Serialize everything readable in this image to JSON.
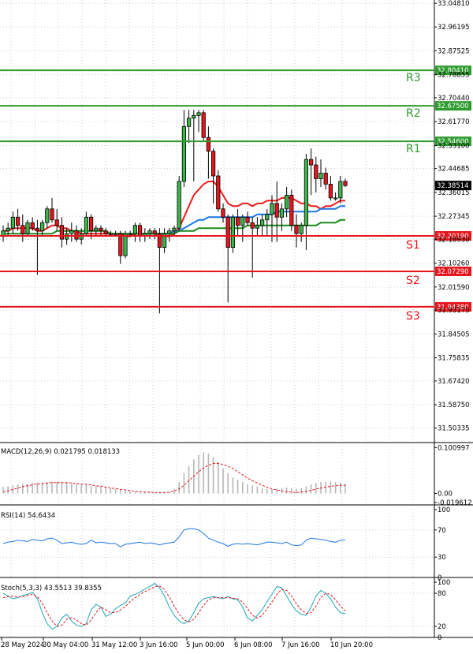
{
  "chart_data": {
    "type": "candlestick",
    "price_axis": {
      "range": [
        31.45,
        33.06
      ],
      "tick_labels": [
        "33.04810",
        "32.96195",
        "32.87525",
        "32.78855",
        "32.70440",
        "32.61770",
        "32.53100",
        "32.44685",
        "32.36015",
        "32.27345",
        "32.18930",
        "32.10260",
        "32.01590",
        "31.93175",
        "31.84505",
        "31.75835",
        "31.67420",
        "31.58750",
        "31.50335"
      ]
    },
    "levels": [
      {
        "name": "R3",
        "value": 32.8041,
        "label": "32.80410",
        "color": "#2e9b2e"
      },
      {
        "name": "R2",
        "value": 32.675,
        "label": "32.67500",
        "color": "#2e9b2e"
      },
      {
        "name": "R1",
        "value": 32.546,
        "label": "32.54600",
        "color": "#2e9b2e"
      },
      {
        "name": "S1",
        "value": 32.2019,
        "label": "32.20190",
        "color": "#e8141b"
      },
      {
        "name": "S2",
        "value": 32.0729,
        "label": "32.07290",
        "color": "#e8141b"
      },
      {
        "name": "S3",
        "value": 31.9438,
        "label": "31.94380",
        "color": "#e8141b"
      }
    ],
    "current_price": {
      "value": 32.38514,
      "label": "32.38514"
    },
    "x_tick_labels": [
      "28 May 2024",
      "30 May 04:00",
      "31 May 12:00",
      "3 Jun 16:00",
      "5 Jun 00:00",
      "6 Jun 08:00",
      "7 Jun 16:00",
      "10 Jun 20:00"
    ],
    "candles": [
      [
        32.2,
        32.24,
        32.18,
        32.22
      ],
      [
        32.22,
        32.25,
        32.2,
        32.23
      ],
      [
        32.23,
        32.29,
        32.21,
        32.27
      ],
      [
        32.27,
        32.3,
        32.22,
        32.24
      ],
      [
        32.24,
        32.28,
        32.18,
        32.21
      ],
      [
        32.21,
        32.26,
        32.2,
        32.25
      ],
      [
        32.25,
        32.27,
        32.22,
        32.23
      ],
      [
        32.23,
        32.26,
        32.06,
        32.22
      ],
      [
        32.22,
        32.26,
        32.2,
        32.25
      ],
      [
        32.25,
        32.31,
        32.23,
        32.3
      ],
      [
        32.3,
        32.34,
        32.25,
        32.26
      ],
      [
        32.26,
        32.3,
        32.22,
        32.24
      ],
      [
        32.24,
        32.27,
        32.16,
        32.19
      ],
      [
        32.19,
        32.23,
        32.17,
        32.21
      ],
      [
        32.21,
        32.25,
        32.18,
        32.22
      ],
      [
        32.22,
        32.24,
        32.18,
        32.19
      ],
      [
        32.19,
        32.23,
        32.17,
        32.21
      ],
      [
        32.21,
        32.29,
        32.2,
        32.27
      ],
      [
        32.27,
        32.28,
        32.19,
        32.22
      ],
      [
        32.22,
        32.24,
        32.2,
        32.23
      ],
      [
        32.23,
        32.24,
        32.2,
        32.22
      ],
      [
        32.22,
        32.23,
        32.2,
        32.21
      ],
      [
        32.21,
        32.22,
        32.2,
        32.21
      ],
      [
        32.21,
        32.22,
        32.2,
        32.21
      ],
      [
        32.21,
        32.22,
        32.1,
        32.13
      ],
      [
        32.13,
        32.22,
        32.12,
        32.21
      ],
      [
        32.21,
        32.22,
        32.2,
        32.21
      ],
      [
        32.21,
        32.25,
        32.18,
        32.24
      ],
      [
        32.24,
        32.25,
        32.18,
        32.2
      ],
      [
        32.2,
        32.23,
        32.18,
        32.21
      ],
      [
        32.21,
        32.23,
        32.19,
        32.22
      ],
      [
        32.22,
        32.23,
        32.19,
        32.21
      ],
      [
        32.21,
        32.23,
        31.92,
        32.16
      ],
      [
        32.16,
        32.23,
        32.14,
        32.21
      ],
      [
        32.21,
        32.23,
        32.18,
        32.22
      ],
      [
        32.22,
        32.24,
        32.2,
        32.23
      ],
      [
        32.23,
        32.42,
        32.22,
        32.4
      ],
      [
        32.4,
        32.66,
        32.38,
        32.6
      ],
      [
        32.6,
        32.66,
        32.54,
        32.63
      ],
      [
        32.63,
        32.66,
        32.4,
        32.64
      ],
      [
        32.64,
        32.66,
        32.58,
        32.65
      ],
      [
        32.65,
        32.66,
        32.55,
        32.56
      ],
      [
        32.56,
        32.6,
        32.41,
        32.51
      ],
      [
        32.51,
        32.52,
        32.32,
        32.42
      ],
      [
        32.42,
        32.44,
        32.29,
        32.3
      ],
      [
        32.3,
        32.32,
        32.25,
        32.27
      ],
      [
        32.27,
        32.28,
        31.96,
        32.16
      ],
      [
        32.16,
        32.28,
        32.14,
        32.27
      ],
      [
        32.27,
        32.3,
        32.2,
        32.24
      ],
      [
        32.24,
        32.28,
        32.18,
        32.27
      ],
      [
        32.27,
        32.29,
        32.24,
        32.25
      ],
      [
        32.25,
        32.27,
        32.05,
        32.23
      ],
      [
        32.23,
        32.27,
        32.2,
        32.24
      ],
      [
        32.24,
        32.28,
        32.2,
        32.26
      ],
      [
        32.26,
        32.3,
        32.2,
        32.28
      ],
      [
        32.28,
        32.35,
        32.18,
        32.32
      ],
      [
        32.32,
        32.4,
        32.18,
        32.27
      ],
      [
        32.27,
        32.32,
        32.22,
        32.3
      ],
      [
        32.3,
        32.38,
        32.27,
        32.35
      ],
      [
        32.35,
        32.37,
        32.22,
        32.24
      ],
      [
        32.24,
        32.28,
        32.16,
        32.21
      ],
      [
        32.21,
        32.25,
        32.18,
        32.24
      ],
      [
        32.24,
        32.5,
        32.15,
        32.48
      ],
      [
        32.48,
        32.52,
        32.35,
        32.46
      ],
      [
        32.46,
        32.49,
        32.36,
        32.41
      ],
      [
        32.41,
        32.48,
        32.38,
        32.43
      ],
      [
        32.43,
        32.45,
        32.37,
        32.39
      ],
      [
        32.39,
        32.42,
        32.33,
        32.34
      ],
      [
        32.34,
        32.36,
        32.33,
        32.34
      ],
      [
        32.34,
        32.42,
        32.32,
        32.4
      ],
      [
        32.4,
        32.41,
        32.38,
        32.385
      ]
    ],
    "moving_averages": [
      {
        "color": "#ee1c1c",
        "values": [
          32.22,
          32.22,
          32.23,
          32.23,
          32.23,
          32.23,
          32.23,
          32.22,
          32.22,
          32.23,
          32.24,
          32.24,
          32.23,
          32.23,
          32.22,
          32.22,
          32.21,
          32.21,
          32.21,
          32.21,
          32.21,
          32.21,
          32.21,
          32.21,
          32.21,
          32.2,
          32.2,
          32.21,
          32.21,
          32.21,
          32.21,
          32.21,
          32.2,
          32.2,
          32.2,
          32.21,
          32.23,
          32.27,
          32.31,
          32.35,
          32.37,
          32.39,
          32.4,
          32.4,
          32.38,
          32.35,
          32.32,
          32.31,
          32.31,
          32.32,
          32.32,
          32.31,
          32.32,
          32.32,
          32.33,
          32.33,
          32.33,
          32.34,
          32.34,
          32.34,
          32.33,
          32.32,
          32.32,
          32.31,
          32.31,
          32.3,
          32.31,
          32.31,
          32.32,
          32.33,
          32.33
        ]
      },
      {
        "color": "#1e77e6",
        "values": [
          null,
          null,
          null,
          null,
          null,
          null,
          null,
          null,
          null,
          null,
          null,
          null,
          null,
          null,
          null,
          null,
          null,
          null,
          null,
          null,
          null,
          null,
          null,
          null,
          null,
          null,
          null,
          null,
          null,
          null,
          32.21,
          32.21,
          32.21,
          32.21,
          32.21,
          32.22,
          32.22,
          32.23,
          32.24,
          32.25,
          32.26,
          32.26,
          32.27,
          32.27,
          32.27,
          32.27,
          32.27,
          32.27,
          32.27,
          32.27,
          32.27,
          32.27,
          32.28,
          32.28,
          32.28,
          32.28,
          32.29,
          32.29,
          32.29,
          32.29,
          32.29,
          32.29,
          32.29,
          32.29,
          32.29,
          32.3,
          32.3,
          32.3,
          32.3,
          32.31,
          32.31
        ]
      },
      {
        "color": "#1b8a1b",
        "values": [
          32.21,
          32.21,
          32.21,
          32.21,
          32.21,
          32.21,
          32.21,
          32.21,
          32.21,
          32.21,
          32.21,
          32.22,
          32.22,
          32.22,
          32.22,
          32.22,
          32.22,
          32.22,
          32.22,
          32.22,
          32.22,
          32.22,
          32.21,
          32.21,
          32.21,
          32.21,
          32.21,
          32.21,
          32.21,
          32.21,
          32.21,
          32.21,
          32.21,
          32.21,
          32.21,
          32.21,
          32.22,
          32.22,
          32.22,
          32.22,
          32.23,
          32.23,
          32.23,
          32.23,
          32.23,
          32.23,
          32.23,
          32.23,
          32.23,
          32.23,
          32.24,
          32.24,
          32.24,
          32.24,
          32.24,
          32.24,
          32.24,
          32.24,
          32.24,
          32.24,
          32.24,
          32.24,
          32.24,
          32.24,
          32.24,
          32.25,
          32.25,
          32.25,
          32.25,
          32.26,
          32.26
        ]
      }
    ],
    "macd": {
      "label": "MACD(12,26,9) 0.021795 0.018133",
      "axis_labels": [
        "0.100997",
        "0.00",
        "-0.019612"
      ],
      "range": [
        -0.025,
        0.105
      ],
      "histogram": [
        0.015,
        0.016,
        0.018,
        0.02,
        0.021,
        0.022,
        0.023,
        0.024,
        0.024,
        0.025,
        0.026,
        0.026,
        0.025,
        0.024,
        0.022,
        0.021,
        0.02,
        0.019,
        0.017,
        0.016,
        0.015,
        0.013,
        0.012,
        0.01,
        0.008,
        0.006,
        0.005,
        0.004,
        0.003,
        0.003,
        0.003,
        0.002,
        0.001,
        0.002,
        0.003,
        0.01,
        0.025,
        0.045,
        0.06,
        0.075,
        0.085,
        0.09,
        0.088,
        0.08,
        0.07,
        0.055,
        0.045,
        0.035,
        0.03,
        0.025,
        0.02,
        0.018,
        0.015,
        0.012,
        0.01,
        0.01,
        0.011,
        0.012,
        0.013,
        0.012,
        0.01,
        0.012,
        0.016,
        0.02,
        0.023,
        0.025,
        0.026,
        0.026,
        0.025,
        0.024,
        0.022
      ],
      "signal": [
        0.003,
        0.006,
        0.009,
        0.012,
        0.015,
        0.017,
        0.019,
        0.021,
        0.022,
        0.023,
        0.024,
        0.024,
        0.024,
        0.024,
        0.023,
        0.022,
        0.021,
        0.02,
        0.019,
        0.017,
        0.016,
        0.014,
        0.012,
        0.011,
        0.009,
        0.008,
        0.006,
        0.005,
        0.004,
        0.003,
        0.003,
        0.002,
        0.002,
        0.002,
        0.003,
        0.005,
        0.01,
        0.018,
        0.028,
        0.038,
        0.048,
        0.056,
        0.062,
        0.066,
        0.066,
        0.064,
        0.06,
        0.055,
        0.048,
        0.041,
        0.034,
        0.028,
        0.023,
        0.018,
        0.014,
        0.01,
        0.008,
        0.006,
        0.004,
        0.003,
        0.002,
        0.003,
        0.005,
        0.007,
        0.01,
        0.012,
        0.014,
        0.016,
        0.017,
        0.018,
        0.018
      ]
    },
    "rsi": {
      "label": "RSI(14) 54.6434",
      "axis_labels": [
        "100",
        "70",
        "30",
        "0"
      ],
      "range": [
        0,
        100
      ],
      "guides": [
        70,
        30
      ],
      "values": [
        50,
        52,
        53,
        55,
        54,
        53,
        56,
        55,
        54,
        57,
        58,
        55,
        50,
        51,
        52,
        50,
        49,
        50,
        55,
        51,
        52,
        51,
        50,
        50,
        45,
        49,
        50,
        51,
        52,
        50,
        51,
        50,
        48,
        50,
        51,
        52,
        60,
        70,
        72,
        72,
        70,
        65,
        58,
        55,
        52,
        50,
        46,
        49,
        50,
        49,
        50,
        49,
        48,
        50,
        52,
        52,
        51,
        50,
        52,
        48,
        47,
        48,
        55,
        58,
        57,
        56,
        55,
        53,
        52,
        55,
        55
      ]
    },
    "stoch": {
      "label": "Stoch(5,3,3) 43.5513 39.8355",
      "axis_labels": [
        "100",
        "80",
        "20",
        "0"
      ],
      "range": [
        0,
        100
      ],
      "guides": [
        80,
        20
      ],
      "k": [
        80,
        75,
        70,
        72,
        76,
        78,
        82,
        70,
        45,
        25,
        15,
        20,
        35,
        42,
        30,
        22,
        20,
        25,
        50,
        60,
        55,
        38,
        42,
        52,
        58,
        62,
        75,
        78,
        82,
        88,
        92,
        98,
        90,
        75,
        55,
        40,
        30,
        25,
        30,
        45,
        62,
        70,
        72,
        74,
        72,
        70,
        74,
        70,
        68,
        55,
        35,
        30,
        40,
        50,
        65,
        78,
        92,
        90,
        75,
        60,
        48,
        42,
        40,
        55,
        75,
        85,
        80,
        70,
        55,
        45,
        43
      ],
      "d": [
        72,
        74,
        75,
        73,
        74,
        76,
        78,
        74,
        62,
        45,
        30,
        20,
        22,
        33,
        36,
        32,
        25,
        22,
        32,
        45,
        55,
        50,
        45,
        45,
        50,
        56,
        65,
        72,
        78,
        83,
        87,
        92,
        93,
        87,
        73,
        57,
        42,
        32,
        28,
        33,
        45,
        58,
        68,
        72,
        72,
        72,
        72,
        71,
        70,
        64,
        53,
        40,
        35,
        40,
        52,
        64,
        78,
        87,
        85,
        75,
        61,
        50,
        43,
        45,
        57,
        72,
        80,
        78,
        68,
        57,
        48
      ]
    }
  }
}
